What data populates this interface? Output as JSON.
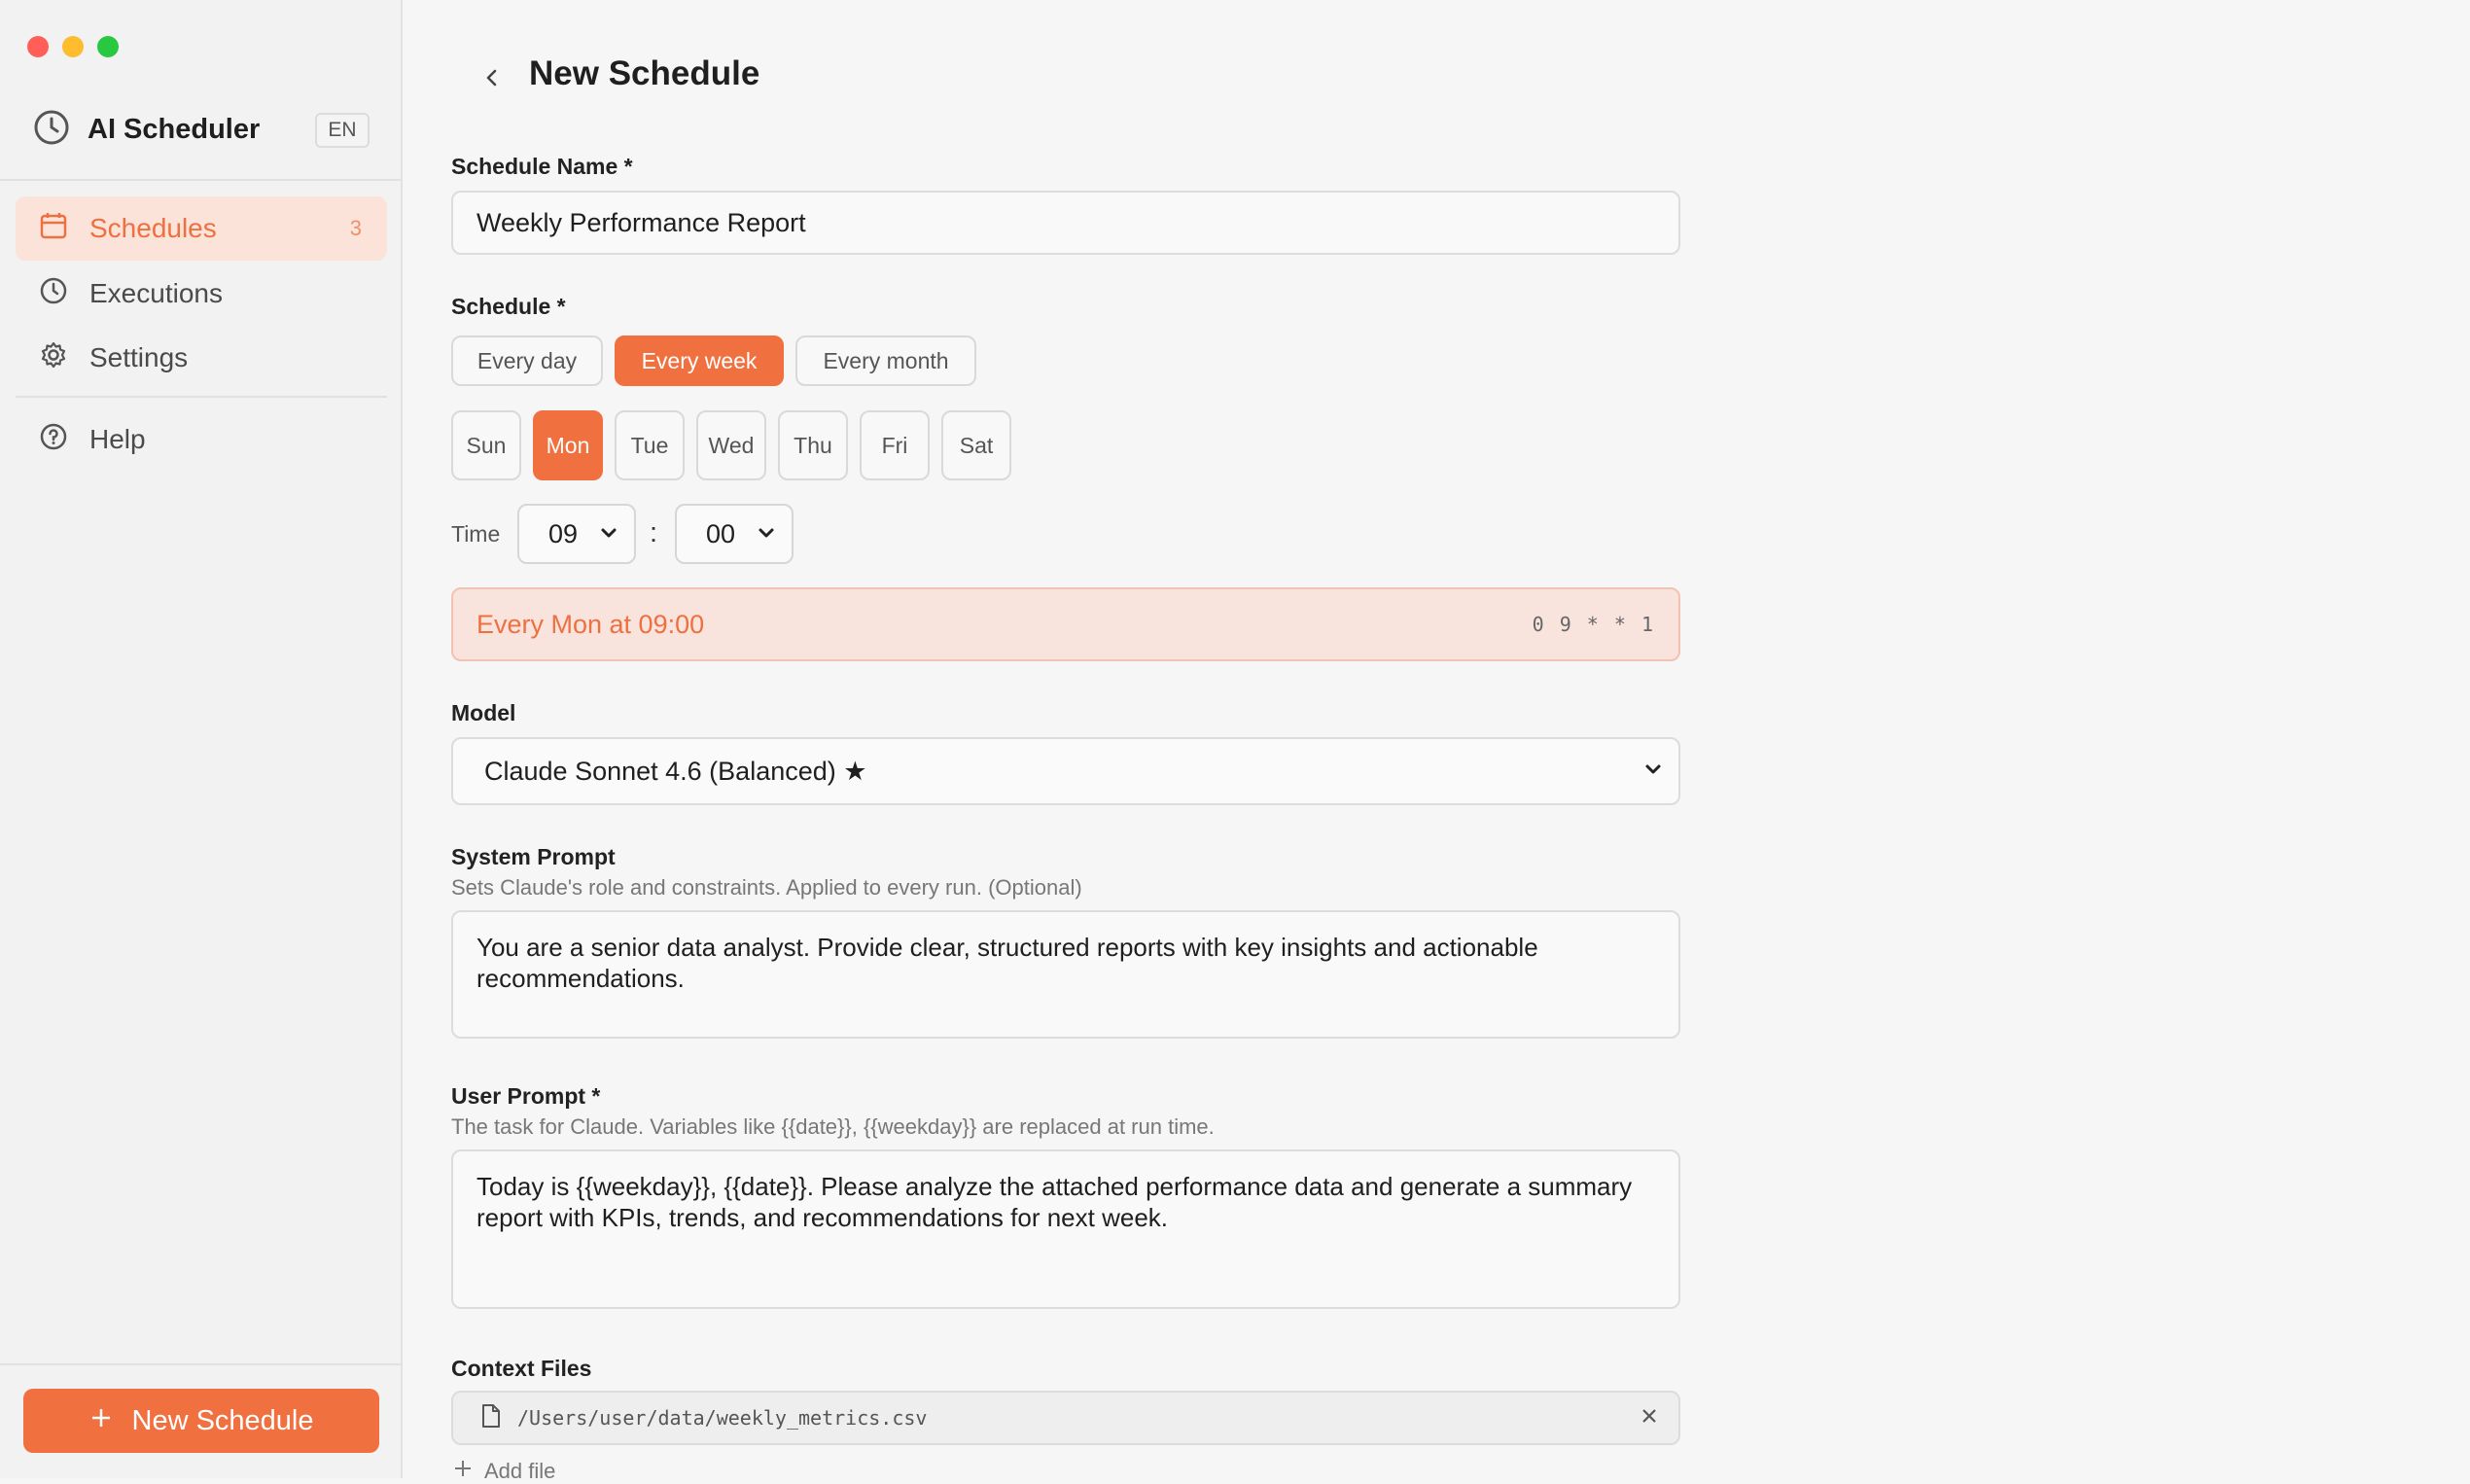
{
  "sidebar": {
    "app_title": "AI Scheduler",
    "language": "EN",
    "nav": [
      {
        "label": "Schedules",
        "count": "3",
        "icon": "calendar-icon",
        "active": true
      },
      {
        "label": "Executions",
        "icon": "clock-icon"
      },
      {
        "label": "Settings",
        "icon": "gear-icon"
      },
      {
        "label": "Help",
        "icon": "help-circle-icon"
      }
    ],
    "new_button": "New Schedule"
  },
  "page": {
    "title": "New Schedule"
  },
  "form": {
    "name": {
      "label": "Schedule Name *",
      "value": "Weekly Performance Report"
    },
    "schedule": {
      "label": "Schedule *",
      "frequencies": [
        "Every day",
        "Every week",
        "Every month"
      ],
      "selected_frequency": "Every week",
      "days": [
        "Sun",
        "Mon",
        "Tue",
        "Wed",
        "Thu",
        "Fri",
        "Sat"
      ],
      "selected_day": "Mon",
      "time_label": "Time",
      "hour": "09",
      "colon": ":",
      "minute": "00",
      "preview": "Every Mon at 09:00",
      "cron": "0 9 * * 1"
    },
    "model": {
      "label": "Model",
      "value": "Claude Sonnet 4.6 (Balanced) ★"
    },
    "system_prompt": {
      "label": "System Prompt",
      "hint": "Sets Claude's role and constraints. Applied to every run. (Optional)",
      "value": "You are a senior data analyst. Provide clear, structured reports with key insights and actionable recommendations."
    },
    "user_prompt": {
      "label": "User Prompt *",
      "hint": "The task for Claude. Variables like {{date}}, {{weekday}} are replaced at run time.",
      "value": "Today is {{weekday}}, {{date}}. Please analyze the attached performance data and generate a summary report with KPIs, trends, and recommendations for next week."
    },
    "context_files": {
      "label": "Context Files",
      "files": [
        "/Users/user/data/weekly_metrics.csv"
      ],
      "add_label": "Add file"
    }
  },
  "colors": {
    "accent": "#f0703f",
    "accent_light": "#fbe3da",
    "background": "#f6f6f6"
  }
}
